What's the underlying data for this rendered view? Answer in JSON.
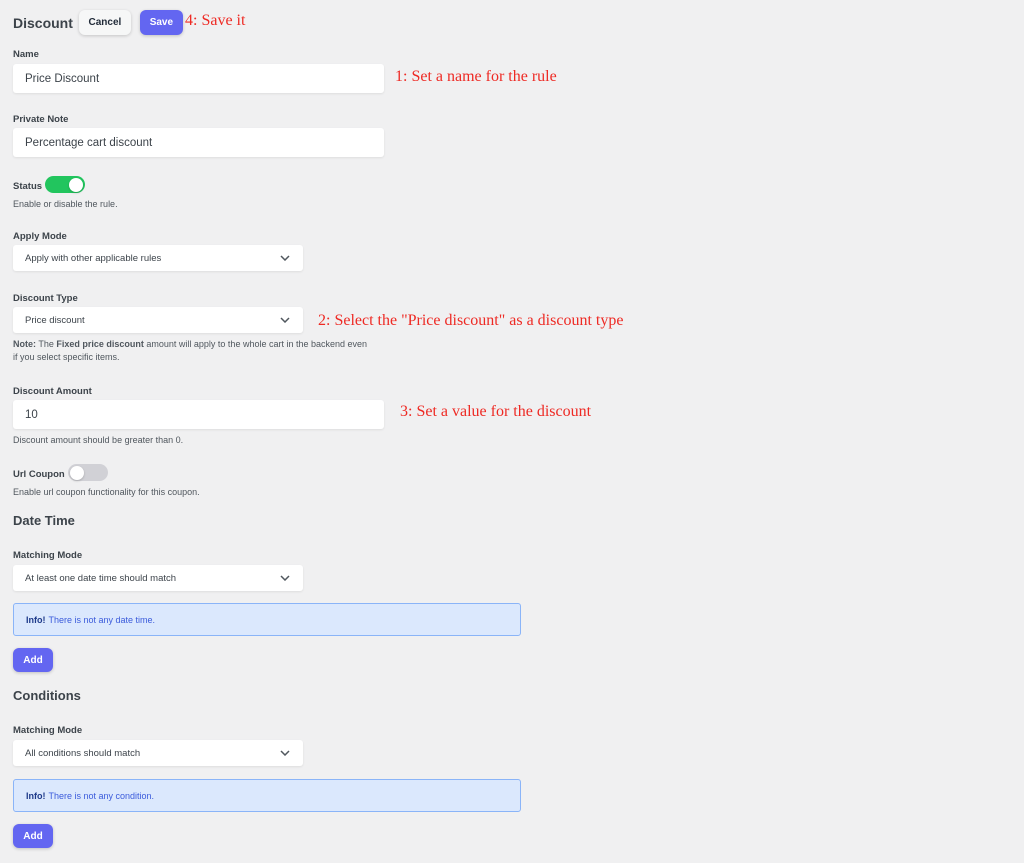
{
  "header": {
    "title": "Discount",
    "cancel_label": "Cancel",
    "save_label": "Save"
  },
  "annotations": {
    "step1": "1: Set a name for the rule",
    "step2": "2: Select the \"Price discount\" as a discount type",
    "step3": "3: Set a value for the discount",
    "step4": "4: Save it"
  },
  "form": {
    "name": {
      "label": "Name",
      "value": "Price Discount"
    },
    "private_note": {
      "label": "Private Note",
      "value": "Percentage cart discount"
    },
    "status": {
      "label": "Status",
      "enabled": true,
      "help": "Enable or disable the rule."
    },
    "apply_mode": {
      "label": "Apply Mode",
      "value": "Apply with other applicable rules"
    },
    "discount_type": {
      "label": "Discount Type",
      "value": "Price discount",
      "note_prefix": "Note:",
      "note_text_1": " The ",
      "note_bold": "Fixed price discount",
      "note_text_2": " amount will apply to the whole cart in the backend even",
      "note_text_3": "if you select specific items."
    },
    "discount_amount": {
      "label": "Discount Amount",
      "value": "10",
      "help": "Discount amount should be greater than 0."
    },
    "url_coupon": {
      "label": "Url Coupon",
      "enabled": false,
      "help": "Enable url coupon functionality for this coupon."
    }
  },
  "date_time": {
    "title": "Date Time",
    "matching_label": "Matching Mode",
    "matching_value": "At least one date time should match",
    "info_prefix": "Info!",
    "info_text": "There is not any date time.",
    "add_label": "Add"
  },
  "conditions": {
    "title": "Conditions",
    "matching_label": "Matching Mode",
    "matching_value": "All conditions should match",
    "info_prefix": "Info!",
    "info_text": "There is not any condition.",
    "add_label": "Add"
  },
  "colors": {
    "primary": "#6366f1",
    "toggle_on": "#22c55e",
    "toggle_off": "#d1d1d6",
    "annotation": "#ee2a24",
    "info_bg": "#dbe8fd",
    "info_border": "#8ab4f8",
    "background": "#f0f0f1"
  }
}
